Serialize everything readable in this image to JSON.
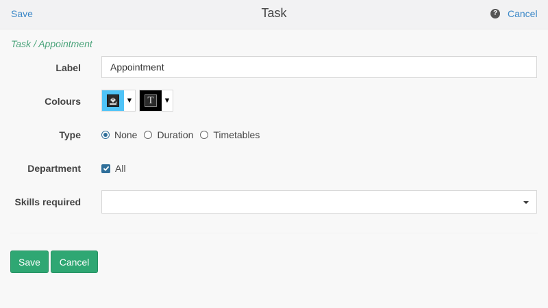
{
  "topbar": {
    "save_label": "Save",
    "title": "Task",
    "help_glyph": "?",
    "cancel_label": "Cancel"
  },
  "breadcrumb": "Task / Appointment",
  "form": {
    "label": {
      "label": "Label",
      "value": "Appointment"
    },
    "colours": {
      "label": "Colours",
      "background_colour": "#4fc3f7",
      "text_colour": "#000000",
      "bg_icon": "paint-bucket-icon",
      "text_icon": "text-T-icon",
      "text_glyph": "T",
      "arrow_glyph": "▼"
    },
    "type": {
      "label": "Type",
      "options": [
        "None",
        "Duration",
        "Timetables"
      ],
      "selected": "None"
    },
    "department": {
      "label": "Department",
      "option": "All",
      "checked": true
    },
    "skills": {
      "label": "Skills required",
      "value": ""
    }
  },
  "footer": {
    "save_label": "Save",
    "cancel_label": "Cancel"
  },
  "colors": {
    "link": "#3a87c7",
    "accent_green": "#2fa773",
    "breadcrumb_green": "#4aa37a",
    "check_blue": "#2f6f9a"
  }
}
